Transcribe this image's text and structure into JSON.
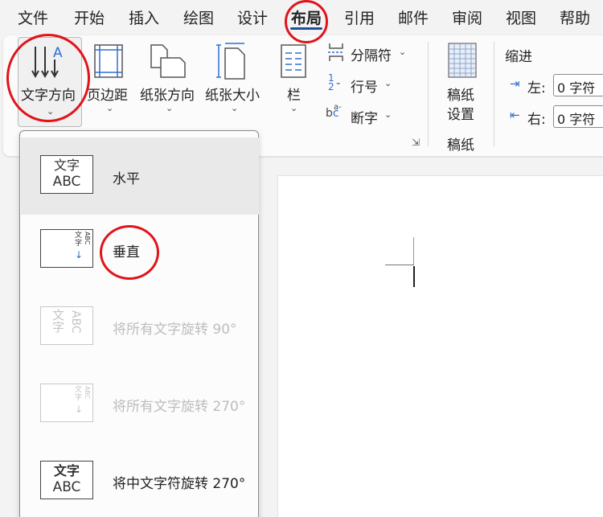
{
  "tabs": [
    "文件",
    "开始",
    "插入",
    "绘图",
    "设计",
    "布局",
    "引用",
    "邮件",
    "审阅",
    "视图",
    "帮助"
  ],
  "active_tab": "布局",
  "ribbon": {
    "text_direction": "文字方向",
    "margins": "页边距",
    "orientation": "纸张方向",
    "size": "纸张大小",
    "columns": "栏",
    "breaks": "分隔符",
    "line_numbers": "行号",
    "hyphenation": "断字",
    "draft_paper_line1": "稿纸",
    "draft_paper_line2": "设置",
    "draft_group": "稿纸",
    "indent_title": "缩进",
    "indent_left_label": "左:",
    "indent_left_value": "0 字符",
    "indent_right_label": "右:",
    "indent_right_value": "0 字符"
  },
  "dropdown": {
    "items": [
      {
        "label": "水平",
        "enabled": true,
        "selected": true
      },
      {
        "label": "垂直",
        "enabled": true,
        "selected": false
      },
      {
        "label": "将所有文字旋转 90°",
        "enabled": false,
        "selected": false
      },
      {
        "label": "将所有文字旋转 270°",
        "enabled": false,
        "selected": false
      },
      {
        "label": "将中文字符旋转 270°",
        "enabled": true,
        "selected": false
      }
    ]
  },
  "icon_text": {
    "line1": "文字",
    "line2": "ABC"
  },
  "colors": {
    "annotation": "#e0141a",
    "accent": "#1f4e9a",
    "icon_blue": "#2f6fd0"
  }
}
